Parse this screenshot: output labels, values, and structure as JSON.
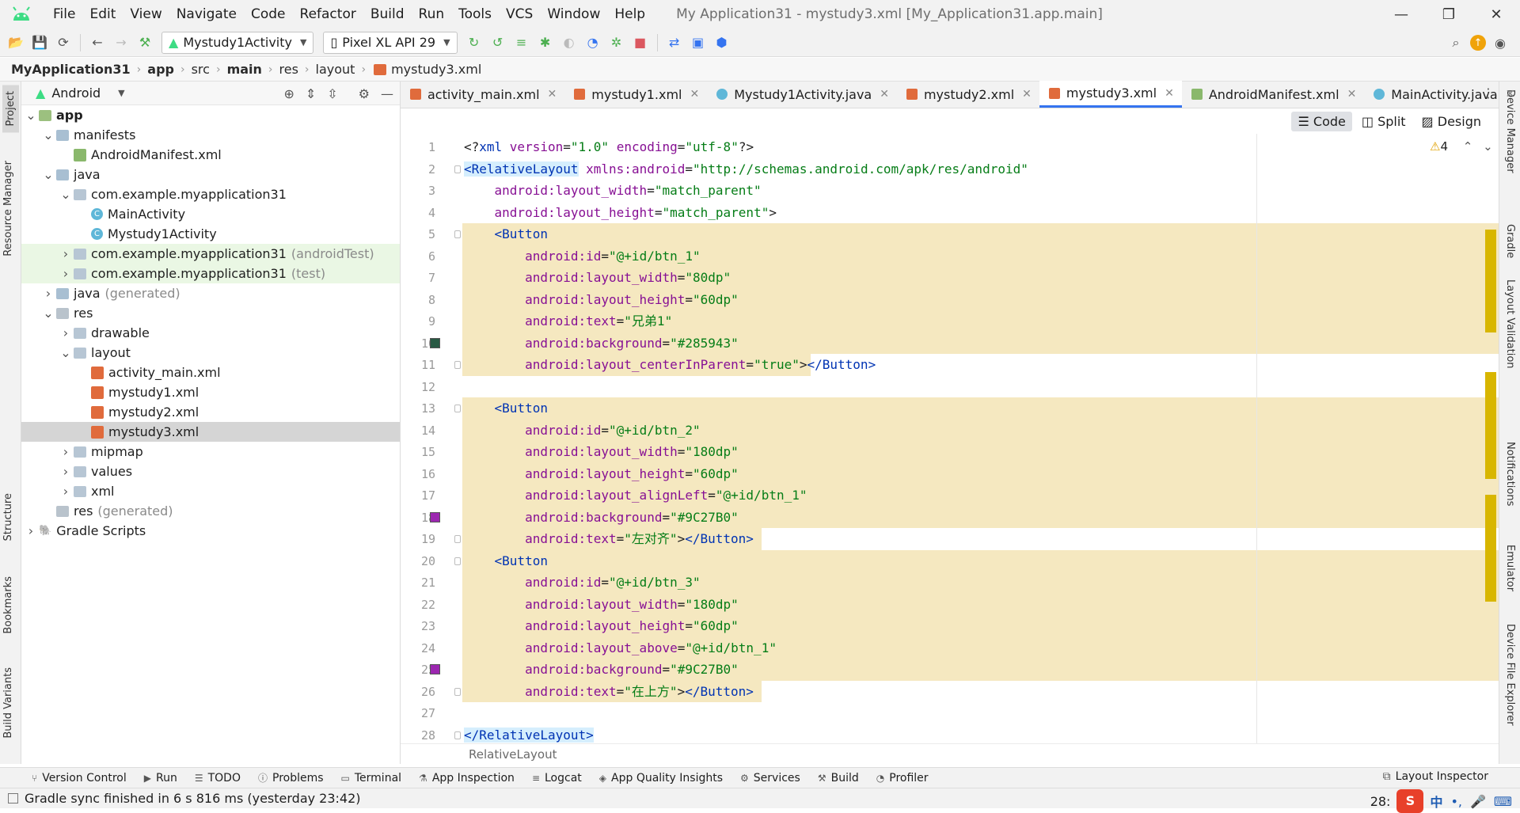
{
  "menu": {
    "items": [
      "File",
      "Edit",
      "View",
      "Navigate",
      "Code",
      "Refactor",
      "Build",
      "Run",
      "Tools",
      "VCS",
      "Window",
      "Help"
    ],
    "title": "My Application31 - mystudy3.xml [My_Application31.app.main]"
  },
  "toolbar": {
    "run_config": "Mystudy1Activity",
    "device": "Pixel XL API 29"
  },
  "breadcrumb": [
    "MyApplication31",
    "app",
    "src",
    "main",
    "res",
    "layout",
    "mystudy3.xml"
  ],
  "left_tabs": [
    "Project",
    "Resource Manager",
    "Structure",
    "Bookmarks",
    "Build Variants"
  ],
  "right_tabs": [
    "Device Manager",
    "Gradle",
    "Layout Validation",
    "Notifications",
    "Emulator",
    "Device File Explorer"
  ],
  "project": {
    "view": "Android",
    "tree": [
      {
        "label": "app",
        "suffix": "",
        "depth": 0,
        "chev": "v",
        "icon": "app",
        "bold": true
      },
      {
        "label": "manifests",
        "suffix": "",
        "depth": 1,
        "chev": "v",
        "icon": "folder"
      },
      {
        "label": "AndroidManifest.xml",
        "suffix": "",
        "depth": 2,
        "chev": "",
        "icon": "mf"
      },
      {
        "label": "java",
        "suffix": "",
        "depth": 1,
        "chev": "v",
        "icon": "folder"
      },
      {
        "label": "com.example.myapplication31",
        "suffix": "",
        "depth": 2,
        "chev": "v",
        "icon": "pkg"
      },
      {
        "label": "MainActivity",
        "suffix": "",
        "depth": 3,
        "chev": "",
        "icon": "cls"
      },
      {
        "label": "Mystudy1Activity",
        "suffix": "",
        "depth": 3,
        "chev": "",
        "icon": "cls"
      },
      {
        "label": "com.example.myapplication31",
        "suffix": "(androidTest)",
        "depth": 2,
        "chev": ">",
        "icon": "pkg",
        "test": true
      },
      {
        "label": "com.example.myapplication31",
        "suffix": "(test)",
        "depth": 2,
        "chev": ">",
        "icon": "pkg",
        "test": true
      },
      {
        "label": "java",
        "suffix": "(generated)",
        "depth": 1,
        "chev": ">",
        "icon": "folder"
      },
      {
        "label": "res",
        "suffix": "",
        "depth": 1,
        "chev": "v",
        "icon": "res"
      },
      {
        "label": "drawable",
        "suffix": "",
        "depth": 2,
        "chev": ">",
        "icon": "pkg"
      },
      {
        "label": "layout",
        "suffix": "",
        "depth": 2,
        "chev": "v",
        "icon": "pkg"
      },
      {
        "label": "activity_main.xml",
        "suffix": "",
        "depth": 3,
        "chev": "",
        "icon": "xmlf"
      },
      {
        "label": "mystudy1.xml",
        "suffix": "",
        "depth": 3,
        "chev": "",
        "icon": "xmlf"
      },
      {
        "label": "mystudy2.xml",
        "suffix": "",
        "depth": 3,
        "chev": "",
        "icon": "xmlf"
      },
      {
        "label": "mystudy3.xml",
        "suffix": "",
        "depth": 3,
        "chev": "",
        "icon": "xmlf",
        "selected": true
      },
      {
        "label": "mipmap",
        "suffix": "",
        "depth": 2,
        "chev": ">",
        "icon": "pkg"
      },
      {
        "label": "values",
        "suffix": "",
        "depth": 2,
        "chev": ">",
        "icon": "pkg"
      },
      {
        "label": "xml",
        "suffix": "",
        "depth": 2,
        "chev": ">",
        "icon": "pkg"
      },
      {
        "label": "res",
        "suffix": "(generated)",
        "depth": 1,
        "chev": "",
        "icon": "res"
      },
      {
        "label": "Gradle Scripts",
        "suffix": "",
        "depth": 0,
        "chev": ">",
        "icon": "gradle"
      }
    ]
  },
  "tabs": [
    {
      "label": "activity_main.xml",
      "kind": "xml"
    },
    {
      "label": "mystudy1.xml",
      "kind": "xml"
    },
    {
      "label": "Mystudy1Activity.java",
      "kind": "java"
    },
    {
      "label": "mystudy2.xml",
      "kind": "xml"
    },
    {
      "label": "mystudy3.xml",
      "kind": "xml",
      "active": true
    },
    {
      "label": "AndroidManifest.xml",
      "kind": "mf"
    },
    {
      "label": "MainActivity.java",
      "kind": "java"
    }
  ],
  "view_modes": {
    "code": "Code",
    "split": "Split",
    "design": "Design"
  },
  "warnings": "4",
  "code_lines": [
    [
      [
        "p",
        "<?"
      ],
      [
        "t",
        "xml "
      ],
      [
        "a",
        "version"
      ],
      [
        "p",
        "="
      ],
      [
        "v",
        "\"1.0\""
      ],
      [
        "p",
        " "
      ],
      [
        "a",
        "encoding"
      ],
      [
        "p",
        "="
      ],
      [
        "v",
        "\"utf-8\""
      ],
      [
        "p",
        "?>"
      ]
    ],
    [
      [
        "tagbg",
        "<RelativeLayout"
      ],
      [
        "p",
        " "
      ],
      [
        "a",
        "xmlns:android"
      ],
      [
        "p",
        "="
      ],
      [
        "v",
        "\"http://schemas.android.com/apk/res/android\""
      ]
    ],
    [
      [
        "p",
        "    "
      ],
      [
        "a",
        "android:layout_width"
      ],
      [
        "p",
        "="
      ],
      [
        "v",
        "\"match_parent\""
      ]
    ],
    [
      [
        "p",
        "    "
      ],
      [
        "a",
        "android:layout_height"
      ],
      [
        "p",
        "="
      ],
      [
        "v",
        "\"match_parent\""
      ],
      [
        "p",
        ">"
      ]
    ],
    [
      [
        "p",
        "    "
      ],
      [
        "t",
        "<Button"
      ]
    ],
    [
      [
        "p",
        "        "
      ],
      [
        "a",
        "android:id"
      ],
      [
        "p",
        "="
      ],
      [
        "v",
        "\"@+id/btn_1\""
      ]
    ],
    [
      [
        "p",
        "        "
      ],
      [
        "a",
        "android:layout_width"
      ],
      [
        "p",
        "="
      ],
      [
        "v",
        "\"80dp\""
      ]
    ],
    [
      [
        "p",
        "        "
      ],
      [
        "a",
        "android:layout_height"
      ],
      [
        "p",
        "="
      ],
      [
        "v",
        "\"60dp\""
      ]
    ],
    [
      [
        "p",
        "        "
      ],
      [
        "a",
        "android:text"
      ],
      [
        "p",
        "="
      ],
      [
        "v",
        "\"兄弟1\""
      ]
    ],
    [
      [
        "p",
        "        "
      ],
      [
        "a",
        "android:background"
      ],
      [
        "p",
        "="
      ],
      [
        "v",
        "\"#285943\""
      ]
    ],
    [
      [
        "p",
        "        "
      ],
      [
        "a",
        "android:layout_centerInParent"
      ],
      [
        "p",
        "="
      ],
      [
        "v",
        "\"true\""
      ],
      [
        "p",
        ">"
      ],
      [
        "t",
        "</Button>"
      ]
    ],
    [
      [
        "p",
        ""
      ]
    ],
    [
      [
        "p",
        "    "
      ],
      [
        "t",
        "<Button"
      ]
    ],
    [
      [
        "p",
        "        "
      ],
      [
        "a",
        "android:id"
      ],
      [
        "p",
        "="
      ],
      [
        "v",
        "\"@+id/btn_2\""
      ]
    ],
    [
      [
        "p",
        "        "
      ],
      [
        "a",
        "android:layout_width"
      ],
      [
        "p",
        "="
      ],
      [
        "v",
        "\"180dp\""
      ]
    ],
    [
      [
        "p",
        "        "
      ],
      [
        "a",
        "android:layout_height"
      ],
      [
        "p",
        "="
      ],
      [
        "v",
        "\"60dp\""
      ]
    ],
    [
      [
        "p",
        "        "
      ],
      [
        "a",
        "android:layout_alignLeft"
      ],
      [
        "p",
        "="
      ],
      [
        "v",
        "\"@+id/btn_1\""
      ]
    ],
    [
      [
        "p",
        "        "
      ],
      [
        "a",
        "android:background"
      ],
      [
        "p",
        "="
      ],
      [
        "v",
        "\"#9C27B0\""
      ]
    ],
    [
      [
        "p",
        "        "
      ],
      [
        "a",
        "android:text"
      ],
      [
        "p",
        "="
      ],
      [
        "v",
        "\"左对齐\""
      ],
      [
        "p",
        ">"
      ],
      [
        "t",
        "</Button>"
      ]
    ],
    [
      [
        "p",
        "    "
      ],
      [
        "t",
        "<Button"
      ]
    ],
    [
      [
        "p",
        "        "
      ],
      [
        "a",
        "android:id"
      ],
      [
        "p",
        "="
      ],
      [
        "v",
        "\"@+id/btn_3\""
      ]
    ],
    [
      [
        "p",
        "        "
      ],
      [
        "a",
        "android:layout_width"
      ],
      [
        "p",
        "="
      ],
      [
        "v",
        "\"180dp\""
      ]
    ],
    [
      [
        "p",
        "        "
      ],
      [
        "a",
        "android:layout_height"
      ],
      [
        "p",
        "="
      ],
      [
        "v",
        "\"60dp\""
      ]
    ],
    [
      [
        "p",
        "        "
      ],
      [
        "a",
        "android:layout_above"
      ],
      [
        "p",
        "="
      ],
      [
        "v",
        "\"@+id/btn_1\""
      ]
    ],
    [
      [
        "p",
        "        "
      ],
      [
        "a",
        "android:background"
      ],
      [
        "p",
        "="
      ],
      [
        "v",
        "\"#9C27B0\""
      ]
    ],
    [
      [
        "p",
        "        "
      ],
      [
        "a",
        "android:text"
      ],
      [
        "p",
        "="
      ],
      [
        "v",
        "\"在上方\""
      ],
      [
        "p",
        ">"
      ],
      [
        "t",
        "</Button>"
      ]
    ],
    [
      [
        "p",
        ""
      ]
    ],
    [
      [
        "tagbg",
        "</RelativeLayout>"
      ]
    ]
  ],
  "swatches": [
    {
      "line": 10,
      "color": "#285943"
    },
    {
      "line": 18,
      "color": "#9C27B0"
    },
    {
      "line": 25,
      "color": "#9C27B0"
    }
  ],
  "editor_breadcrumb": "RelativeLayout",
  "bottom_tools": [
    "Version Control",
    "Run",
    "TODO",
    "Problems",
    "Terminal",
    "App Inspection",
    "Logcat",
    "App Quality Insights",
    "Services",
    "Build",
    "Profiler"
  ],
  "layout_inspector": "Layout Inspector",
  "status": {
    "message": "Gradle sync finished in 6 s 816 ms (yesterday 23:42)",
    "position": "28:",
    "ime": "S",
    "ime_lang": "中"
  }
}
